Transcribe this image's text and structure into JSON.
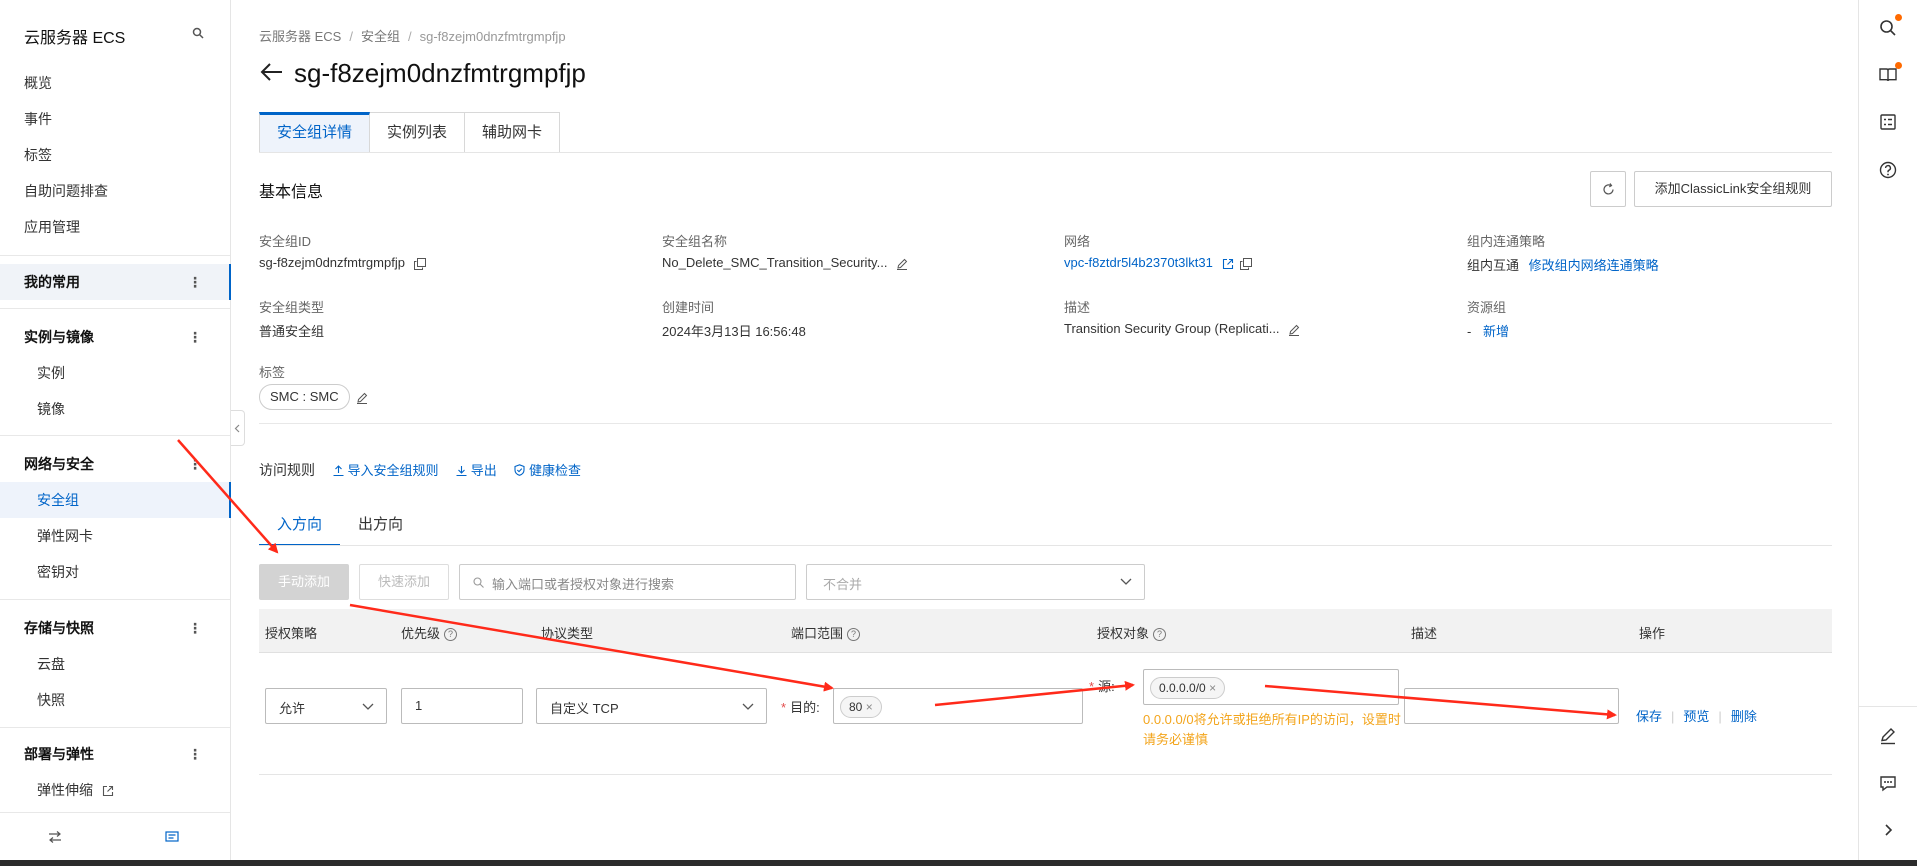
{
  "sidebar": {
    "title": "云服务器 ECS",
    "top_items": [
      "概览",
      "事件",
      "标签",
      "自助问题排查",
      "应用管理"
    ],
    "mine": "我的常用",
    "groups": {
      "instances": {
        "label": "实例与镜像",
        "items": [
          "实例",
          "镜像"
        ]
      },
      "network": {
        "label": "网络与安全",
        "items": [
          "安全组",
          "弹性网卡",
          "密钥对"
        ]
      },
      "storage": {
        "label": "存储与快照",
        "items": [
          "云盘",
          "快照"
        ]
      },
      "deploy": {
        "label": "部署与弹性",
        "items": [
          "弹性伸缩"
        ]
      }
    },
    "more": "⋮"
  },
  "breadcrumb": [
    "云服务器 ECS",
    "安全组",
    "sg-f8zejm0dnzfmtrgmpfjp"
  ],
  "breadcrumb_sep": "/",
  "page_title": "sg-f8zejm0dnzfmtrgmpfjp",
  "tabs": [
    "安全组详情",
    "实例列表",
    "辅助网卡"
  ],
  "basic": {
    "title": "基本信息",
    "classic_button": "添加ClassicLink安全组规则",
    "fields": {
      "sg_id": {
        "label": "安全组ID",
        "value": "sg-f8zejm0dnzfmtrgmpfjp"
      },
      "sg_name": {
        "label": "安全组名称",
        "value": "No_Delete_SMC_Transition_Security..."
      },
      "network": {
        "label": "网络",
        "value": "vpc-f8ztdr5l4b2370t3lkt31"
      },
      "policy": {
        "label": "组内连通策略",
        "value": "组内互通",
        "link": "修改组内网络连通策略"
      },
      "sg_type": {
        "label": "安全组类型",
        "value": "普通安全组"
      },
      "created": {
        "label": "创建时间",
        "value": "2024年3月13日 16:56:48"
      },
      "desc": {
        "label": "描述",
        "value": "Transition Security Group (Replicati..."
      },
      "rg": {
        "label": "资源组",
        "value": "-",
        "link": "新增"
      },
      "tags": {
        "label": "标签",
        "value": "SMC : SMC"
      }
    }
  },
  "access": {
    "title": "访问规则",
    "import": "导入安全组规则",
    "export": "导出",
    "health": "健康检查",
    "dir_tabs": [
      "入方向",
      "出方向"
    ],
    "manual_add": "手动添加",
    "quick_add": "快速添加",
    "search_placeholder": "输入端口或者授权对象进行搜索",
    "merge_placeholder": "不合并",
    "columns": [
      "授权策略",
      "优先级",
      "协议类型",
      "端口范围",
      "授权对象",
      "描述",
      "操作"
    ],
    "row": {
      "policy": "允许",
      "priority": "1",
      "protocol": "自定义 TCP",
      "dest_label": "目的:",
      "port": "80",
      "src_label": "源:",
      "source": "0.0.0.0/0",
      "source_warning": "0.0.0.0/0将允许或拒绝所有IP的访问，设置时请务必谨慎",
      "ops": [
        "保存",
        "预览",
        "删除"
      ]
    }
  },
  "colors": {
    "accent": "#0064c8",
    "warning": "#f3a51d",
    "annotation": "#ff2a1a"
  }
}
